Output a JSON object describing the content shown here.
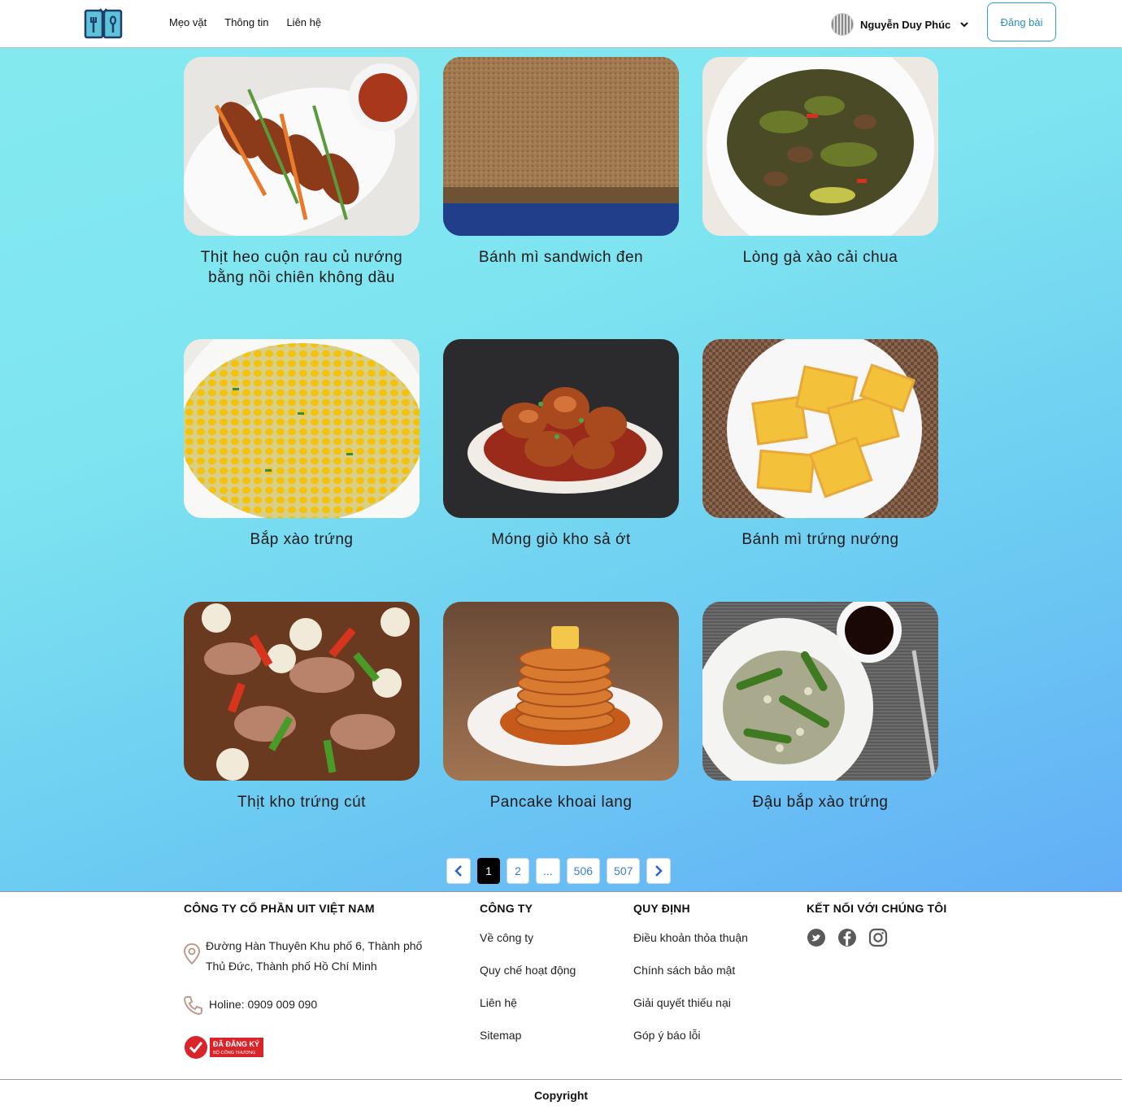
{
  "header": {
    "nav": [
      "Mẹo vặt",
      "Thông tin",
      "Liên hệ"
    ],
    "user_name": "Nguyễn Duy Phúc",
    "post_button": "Đăng bài"
  },
  "recipes": [
    {
      "title": "Thịt heo cuộn rau củ nướng bằng nồi chiên không dầu",
      "image": "grilled-pork-rolls-photo"
    },
    {
      "title": "Bánh mì sandwich đen",
      "image": "brown-bread-loaf-photo"
    },
    {
      "title": "Lòng gà xào cải chua",
      "image": "chicken-giblets-stir-fry-photo"
    },
    {
      "title": "Bắp xào trứng",
      "image": "corn-egg-stir-fry-photo"
    },
    {
      "title": "Móng giò kho sả ớt",
      "image": "braised-pork-trotters-photo"
    },
    {
      "title": "Bánh mì trứng nướng",
      "image": "egg-toast-photo"
    },
    {
      "title": "Thịt kho trứng cút",
      "image": "braised-pork-quail-eggs-photo"
    },
    {
      "title": "Pancake khoai lang",
      "image": "sweet-potato-pancake-photo"
    },
    {
      "title": "Đậu bắp xào trứng",
      "image": "okra-egg-stir-fry-photo"
    }
  ],
  "pagination": {
    "pages": [
      "1",
      "2",
      "...",
      "506",
      "507"
    ],
    "current": "1"
  },
  "footer": {
    "company": {
      "heading": "CÔNG TY CỔ PHẦN UIT VIỆT NAM",
      "address": "Đường Hàn Thuyên Khu phố 6, Thành phố Thủ Đức, Thành phố Hồ Chí Minh",
      "hotline": "Holine: 0909 009 090",
      "badge_text": "ĐÃ ĐĂNG KÝ",
      "badge_sub": "BỘ CÔNG THƯƠNG"
    },
    "about": {
      "heading": "CÔNG TY",
      "links": [
        "Về công ty",
        "Quy chế hoạt động",
        "Liên hệ",
        "Sitemap"
      ]
    },
    "rules": {
      "heading": "QUY ĐỊNH",
      "links": [
        "Điều khoản thỏa thuận",
        "Chính sách bảo mật",
        "Giải quyết thiếu nại",
        "Góp ý báo lỗi"
      ]
    },
    "connect": {
      "heading": "KẾT NỐI VỚI CHÚNG TÔI",
      "icons": [
        "twitter-icon",
        "facebook-icon",
        "instagram-icon"
      ]
    },
    "copyright": "Copyright"
  }
}
